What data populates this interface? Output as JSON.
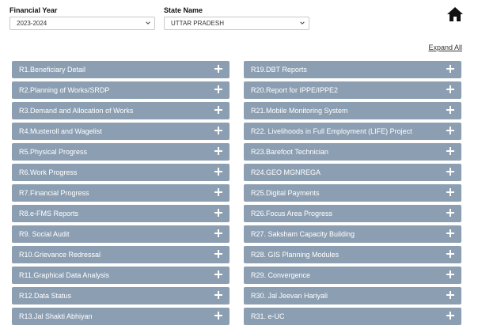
{
  "filters": {
    "financial_year_label": "Financial Year",
    "financial_year_value": "2023-2024",
    "state_label": "State Name",
    "state_value": "UTTAR PRADESH"
  },
  "home_icon": "home-icon",
  "expand_all": "Expand All",
  "left_items": [
    "R1.Beneficiary Detail",
    "R2.Planning of Works/SRDP",
    "R3.Demand and Allocation of Works",
    "R4.Musteroll and Wagelist",
    "R5.Physical Progress",
    "R6.Work Progress",
    "R7.Financial Progress",
    "R8.e-FMS Reports",
    "R9. Social Audit",
    "R10.Grievance Redressal",
    "R11.Graphical Data Analysis",
    "R12.Data Status",
    "R13.Jal Shakti Abhiyan"
  ],
  "right_items": [
    "R19.DBT Reports",
    "R20.Report for IPPE/IPPE2",
    "R21.Mobile Monitoring System",
    "R22. Livelihoods in Full Employment (LIFE) Project",
    "R23.Barefoot Technician",
    "R24.GEO MGNREGA",
    "R25.Digital Payments",
    "R26.Focus Area Progress",
    "R27. Saksham Capacity Building",
    "R28. GIS Planning Modules",
    "R29. Convergence",
    "R30. Jal Jeevan Hariyali",
    "R31. e-UC"
  ],
  "colors": {
    "item_bg": "#8c9fb2",
    "item_text": "#ffffff"
  }
}
